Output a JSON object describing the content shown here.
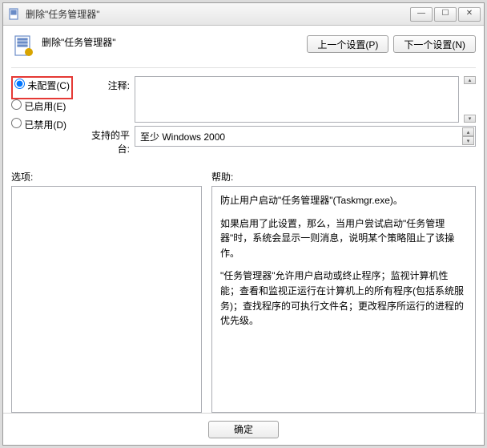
{
  "titlebar": {
    "title": "删除\"任务管理器\""
  },
  "header": {
    "title": "删除\"任务管理器\""
  },
  "nav": {
    "prev": "上一个设置(P)",
    "next": "下一个设置(N)"
  },
  "radios": {
    "not_configured": "未配置(C)",
    "enabled": "已启用(E)",
    "disabled": "已禁用(D)"
  },
  "labels": {
    "comment": "注释:",
    "platform": "支持的平台:",
    "options": "选项:",
    "help": "帮助:"
  },
  "platform": {
    "value": "至少 Windows 2000"
  },
  "help": {
    "p1": "防止用户启动\"任务管理器\"(Taskmgr.exe)。",
    "p2": "如果启用了此设置，那么，当用户尝试启动\"任务管理器\"时，系统会显示一则消息，说明某个策略阻止了该操作。",
    "p3": "\"任务管理器\"允许用户启动或终止程序；监视计算机性能；查看和监视正运行在计算机上的所有程序(包括系统服务)；查找程序的可执行文件名；更改程序所运行的进程的优先级。"
  },
  "footer": {
    "ok": "确定"
  }
}
